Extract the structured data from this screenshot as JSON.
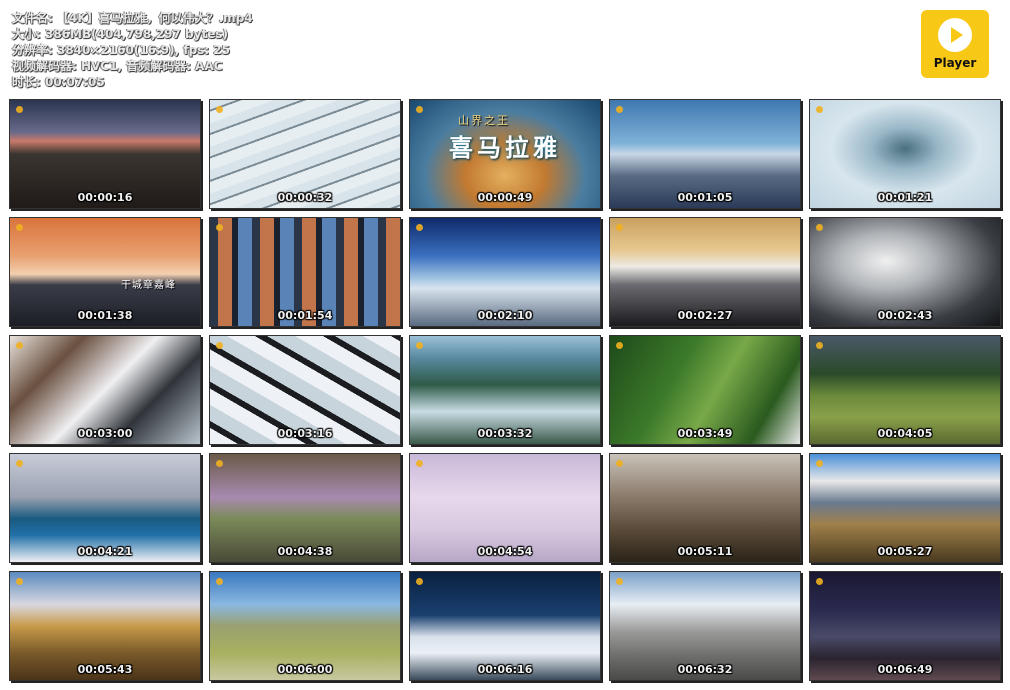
{
  "file_info": {
    "filename": "文件名: 【4K】喜马拉雅，何以伟大？.mp4",
    "size": "大小: 386MB(404,798,297 bytes)",
    "resolution": "分辨率: 3840×2160(16:9), fps: 25",
    "codecs": "视频解码器: HVC1, 音频解码器: AAC",
    "duration": "时长: 00:07:05"
  },
  "logo": {
    "label": "Player",
    "icon": "play-icon",
    "color": "#f7c815"
  },
  "thumbnails": [
    {
      "time": "00:00:16",
      "scene": "s1"
    },
    {
      "time": "00:00:32",
      "scene": "s2"
    },
    {
      "time": "00:00:49",
      "scene": "s3",
      "sub": "山界之王",
      "title": "喜马拉雅"
    },
    {
      "time": "00:01:05",
      "scene": "s4"
    },
    {
      "time": "00:01:21",
      "scene": "s5"
    },
    {
      "time": "00:01:38",
      "scene": "s6",
      "caption": "干城章嘉峰"
    },
    {
      "time": "00:01:54",
      "scene": "s7"
    },
    {
      "time": "00:02:10",
      "scene": "s8"
    },
    {
      "time": "00:02:27",
      "scene": "s9"
    },
    {
      "time": "00:02:43",
      "scene": "s10"
    },
    {
      "time": "00:03:00",
      "scene": "s11"
    },
    {
      "time": "00:03:16",
      "scene": "s12"
    },
    {
      "time": "00:03:32",
      "scene": "s13"
    },
    {
      "time": "00:03:49",
      "scene": "s14"
    },
    {
      "time": "00:04:05",
      "scene": "s15"
    },
    {
      "time": "00:04:21",
      "scene": "s16"
    },
    {
      "time": "00:04:38",
      "scene": "s17"
    },
    {
      "time": "00:04:54",
      "scene": "s18"
    },
    {
      "time": "00:05:11",
      "scene": "s19"
    },
    {
      "time": "00:05:27",
      "scene": "s20"
    },
    {
      "time": "00:05:43",
      "scene": "s21"
    },
    {
      "time": "00:06:00",
      "scene": "s22"
    },
    {
      "time": "00:06:16",
      "scene": "s23"
    },
    {
      "time": "00:06:32",
      "scene": "s24"
    },
    {
      "time": "00:06:49",
      "scene": "s25"
    }
  ]
}
